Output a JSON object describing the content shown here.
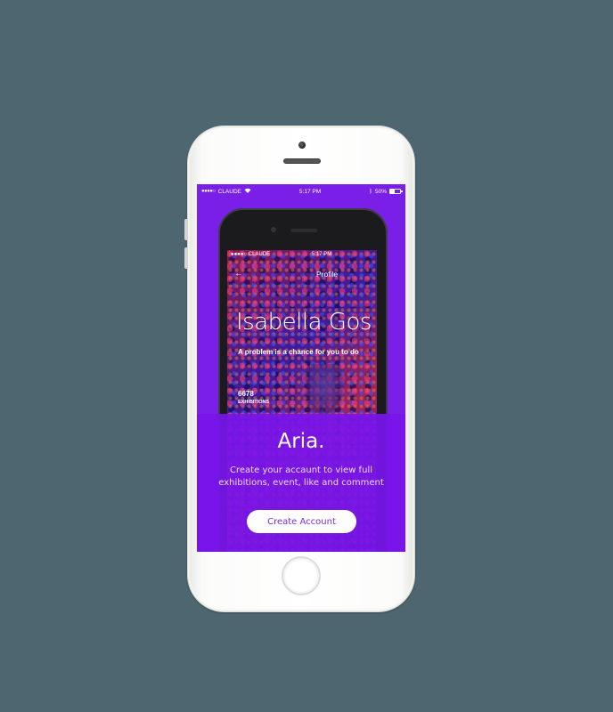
{
  "outer_status": {
    "carrier": "CLAUDE",
    "time": "5:17 PM",
    "battery": "50%",
    "battery_level": 0.5
  },
  "inner_status": {
    "carrier": "CLAUDE",
    "time": "5:17 PM"
  },
  "profile": {
    "header_title": "Profile",
    "name": "Isabella Gos",
    "quote": "A problem is a chance for you to do",
    "stat_number": "6678",
    "stat_label": "EXHIBITIONS"
  },
  "onboarding": {
    "brand": "Aria.",
    "tagline": "Create your accaunt to view full exhibitions, event, like and comment",
    "cta_label": "Create Account"
  },
  "colors": {
    "background": "#4d6670",
    "accent_purple": "#7a1fe8",
    "button_text": "#7a2ae4"
  }
}
